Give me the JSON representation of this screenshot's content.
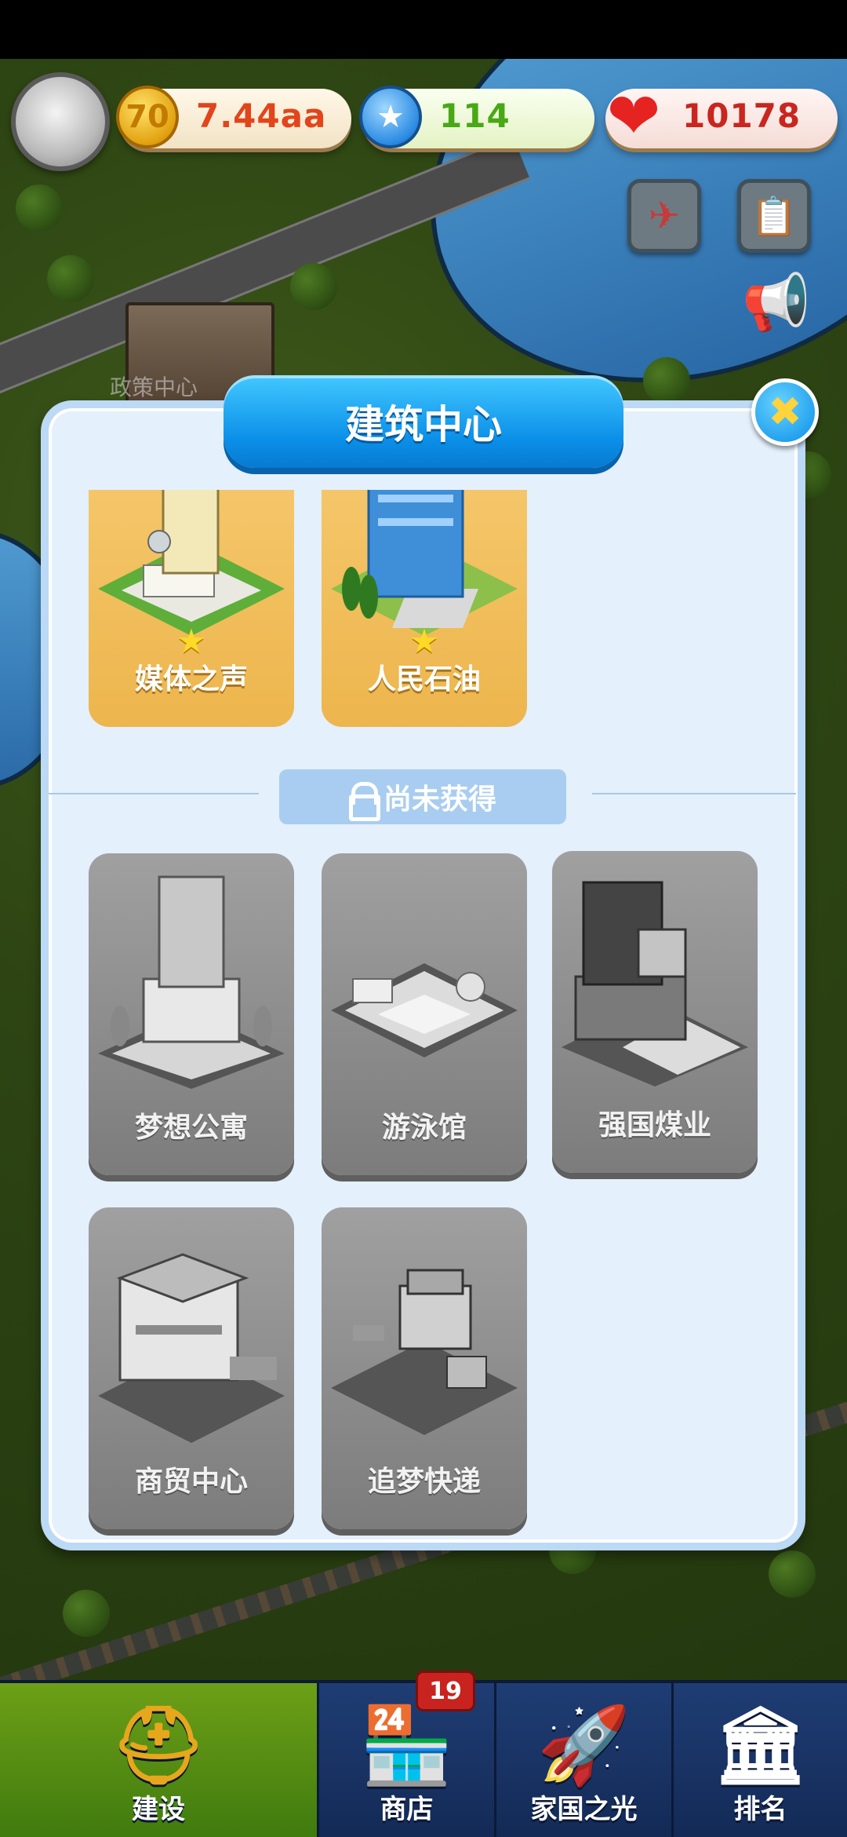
{
  "hud": {
    "coins": "7.44aa",
    "coin_symbol": "70",
    "gems": "114",
    "gem_symbol": "★",
    "hearts": "10178",
    "heart_symbol": "❤"
  },
  "map": {
    "policy_center_label": "政策中心"
  },
  "dialog": {
    "title": "建筑中心",
    "close_symbol": "✖",
    "owned": [
      {
        "label": "媒体之声",
        "star": "★"
      },
      {
        "label": "人民石油",
        "star": "★"
      }
    ],
    "locked_section_label": "尚未获得",
    "locked": [
      {
        "label": "梦想公寓"
      },
      {
        "label": "游泳馆"
      },
      {
        "label": "强国煤业"
      },
      {
        "label": "商贸中心"
      },
      {
        "label": "追梦快递"
      }
    ]
  },
  "nav": {
    "items": [
      {
        "label": "建设",
        "icon": "⛑"
      },
      {
        "label": "商店",
        "icon": "🏪"
      },
      {
        "label": "家国之光",
        "icon": "🚀"
      },
      {
        "label": "排名",
        "icon": "🏛"
      }
    ],
    "shop_badge": "19"
  },
  "colors": {
    "accent": "#0a8fe8",
    "panel_bg": "#e4f0fb",
    "owned_card": "#edb54d",
    "locked_card": "#7c7c7c"
  }
}
